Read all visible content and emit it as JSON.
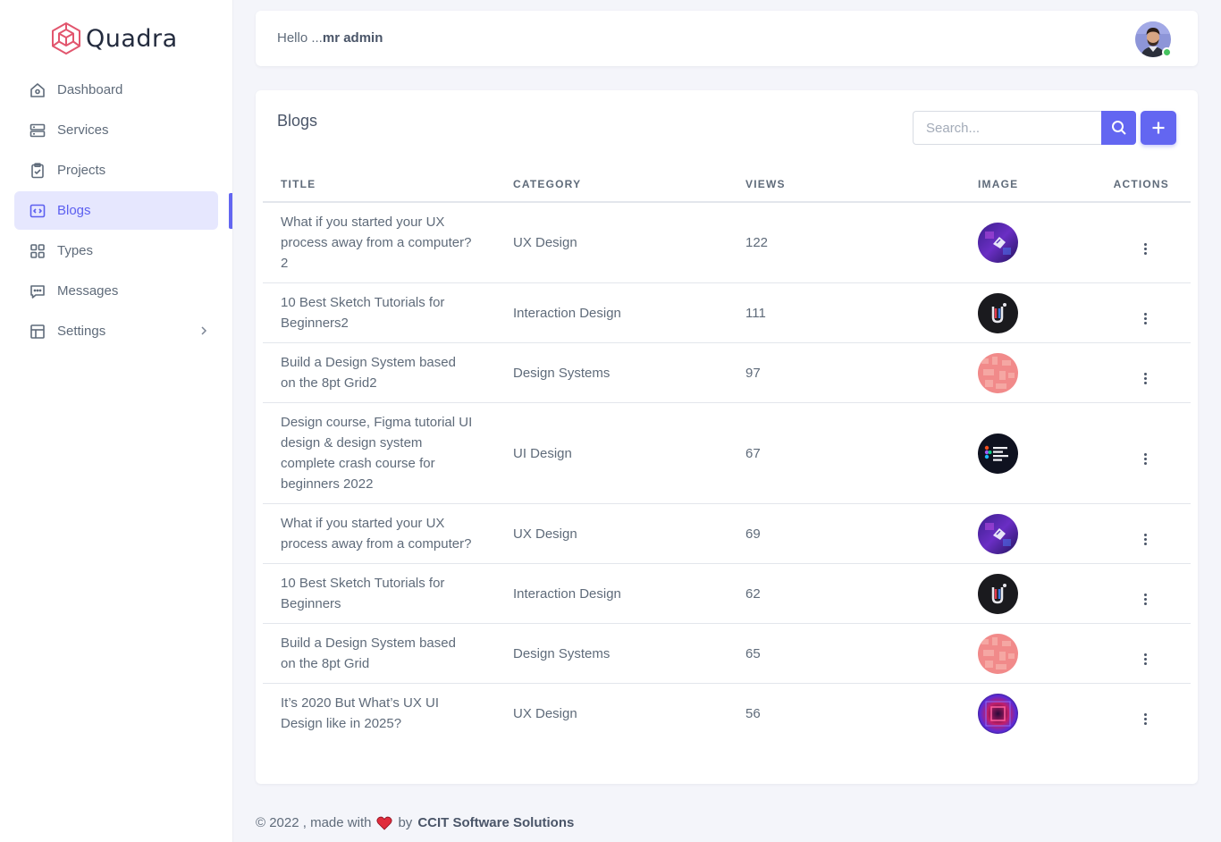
{
  "brand": {
    "name": "Quadra",
    "accent": "#6366f1"
  },
  "sidebar": {
    "items": [
      {
        "label": "Dashboard",
        "icon": "home-icon"
      },
      {
        "label": "Services",
        "icon": "server-icon"
      },
      {
        "label": "Projects",
        "icon": "clipboard-icon"
      },
      {
        "label": "Blogs",
        "icon": "code-window-icon",
        "active": true
      },
      {
        "label": "Types",
        "icon": "grid-icon"
      },
      {
        "label": "Messages",
        "icon": "message-icon"
      },
      {
        "label": "Settings",
        "icon": "layout-icon",
        "has_submenu": true
      }
    ]
  },
  "header": {
    "greeting": "Hello ...",
    "user": "mr admin"
  },
  "blogs": {
    "title": "Blogs",
    "search_placeholder": "Search...",
    "columns": {
      "title": "Title",
      "category": "Category",
      "views": "Views",
      "image": "Image",
      "actions": "Actions"
    },
    "rows": [
      {
        "title": "What if you started your UX process away from a computer?2",
        "category": "UX Design",
        "views": "122",
        "image": "purple-abstract"
      },
      {
        "title": "10 Best Sketch Tutorials for Beginners2",
        "category": "Interaction Design",
        "views": "111",
        "image": "ui-logo-dark"
      },
      {
        "title": "Build a Design System based on the 8pt Grid2",
        "category": "Design Systems",
        "views": "97",
        "image": "pink-grid"
      },
      {
        "title": "Design course, Figma tutorial UI design & design system complete crash course for beginners 2022",
        "category": "UI Design",
        "views": "67",
        "image": "figma-tutorial"
      },
      {
        "title": "What if you started your UX process away from a computer?",
        "category": "UX Design",
        "views": "69",
        "image": "purple-abstract"
      },
      {
        "title": "10 Best Sketch Tutorials for Beginners",
        "category": "Interaction Design",
        "views": "62",
        "image": "ui-logo-dark"
      },
      {
        "title": "Build a Design System based on the 8pt Grid",
        "category": "Design Systems",
        "views": "65",
        "image": "pink-grid"
      },
      {
        "title": "It’s 2020 But What’s UX UI Design like in 2025?",
        "category": "UX Design",
        "views": "56",
        "image": "neon-tunnel"
      }
    ]
  },
  "footer": {
    "prefix": "© 2022 , made with",
    "by": "by",
    "company": "CCIT Software Solutions"
  }
}
